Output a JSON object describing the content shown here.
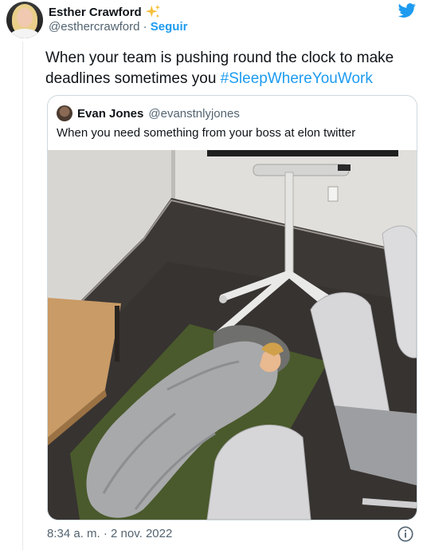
{
  "author": {
    "name": "Esther Crawford",
    "badge_emoji": "✨",
    "handle": "@esthercrawford",
    "separator": "·",
    "follow_label": "Seguir"
  },
  "tweet": {
    "text_before_hashtag": "When your team is pushing round the clock to make deadlines sometimes you ",
    "hashtag": "#SleepWhereYouWork"
  },
  "quoted_tweet": {
    "name": "Evan Jones",
    "handle": "@evanstnlyjones",
    "text": "When you need something from your boss at elon twitter"
  },
  "timestamp": "8:34 a. m. · 2 nov. 2022",
  "icons": {
    "brand": "twitter-bird-icon",
    "info": "info-icon",
    "sparkles": "sparkles-icon"
  },
  "colors": {
    "accent": "#1d9bf0",
    "secondary_text": "#536471",
    "primary_text": "#0f1419",
    "border": "#cfd9de"
  }
}
